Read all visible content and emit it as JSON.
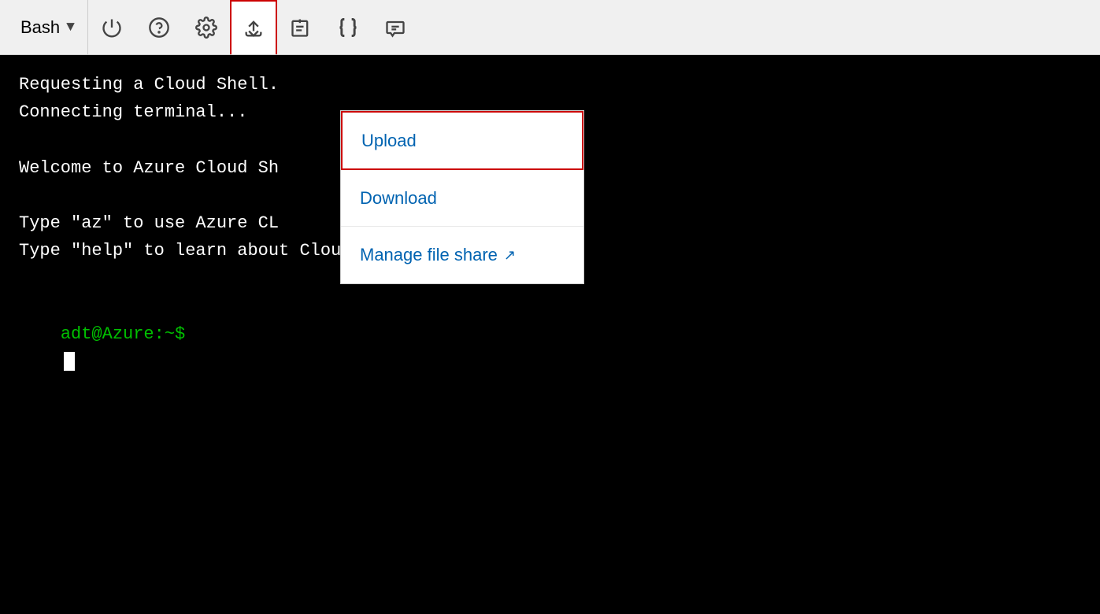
{
  "toolbar": {
    "shell_label": "Bash",
    "chevron": "▾",
    "buttons": [
      {
        "name": "power-button",
        "icon": "power"
      },
      {
        "name": "help-button",
        "icon": "question"
      },
      {
        "name": "settings-button",
        "icon": "gear"
      },
      {
        "name": "upload-download-button",
        "icon": "upload-download",
        "active": true
      },
      {
        "name": "new-tab-button",
        "icon": "new-tab"
      },
      {
        "name": "code-button",
        "icon": "braces"
      },
      {
        "name": "annotate-button",
        "icon": "annotate"
      }
    ]
  },
  "menu": {
    "items": [
      {
        "label": "Upload",
        "name": "upload-item",
        "highlighted": true,
        "external": false
      },
      {
        "label": "Download",
        "name": "download-item",
        "highlighted": false,
        "external": false
      },
      {
        "label": "Manage file share",
        "name": "manage-file-share-item",
        "highlighted": false,
        "external": true
      }
    ]
  },
  "terminal": {
    "lines": [
      "Requesting a Cloud Shell.",
      "Connecting terminal...",
      "",
      "Welcome to Azure Cloud Sh",
      "",
      "Type \"az\" to use Azure CL",
      "Type \"help\" to learn about Cloud Shell",
      ""
    ],
    "prompt": "adt@Azure:~$"
  }
}
